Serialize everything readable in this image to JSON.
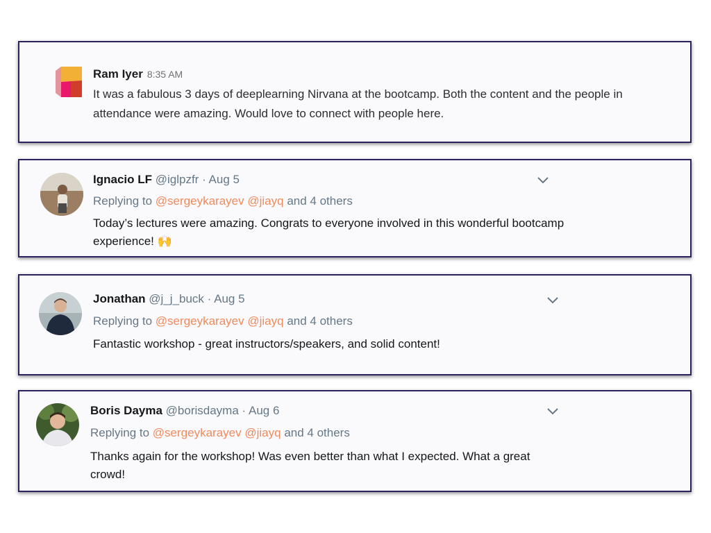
{
  "slack": {
    "author": "Ram Iyer",
    "time": "8:35 AM",
    "text": "It was a fabulous 3 days of deeplearning Nirvana at the bootcamp. Both the content and the people in attendance were amazing. Would love to connect with people here."
  },
  "tweets": [
    {
      "name": "Ignacio LF",
      "handle": "@iglpzfr",
      "dot": "·",
      "date": "Aug 5",
      "replying_prefix": "Replying to",
      "mention1": "@sergeykarayev",
      "mention2": "@jiayq",
      "others": "and 4 others",
      "text": "Today’s lectures were amazing. Congrats to everyone involved in this wonderful bootcamp experience! 🙌"
    },
    {
      "name": "Jonathan",
      "handle": "@j_j_buck",
      "dot": "·",
      "date": "Aug 5",
      "replying_prefix": "Replying to",
      "mention1": "@sergeykarayev",
      "mention2": "@jiayq",
      "others": "and 4 others",
      "text": "Fantastic workshop - great instructors/speakers, and solid content!"
    },
    {
      "name": "Boris Dayma",
      "handle": "@borisdayma",
      "dot": "·",
      "date": "Aug 6",
      "replying_prefix": "Replying to",
      "mention1": "@sergeykarayev",
      "mention2": "@jiayq",
      "others": "and 4 others",
      "text": "Thanks again for the workshop! Was even better than what I expected. What a great crowd!"
    }
  ],
  "icons": {
    "slack_logo": "slack-logo",
    "chevron": "chevron-down-icon"
  },
  "colors": {
    "card_border": "#2b2360",
    "mention": "#f08a5d",
    "muted": "#657786"
  }
}
